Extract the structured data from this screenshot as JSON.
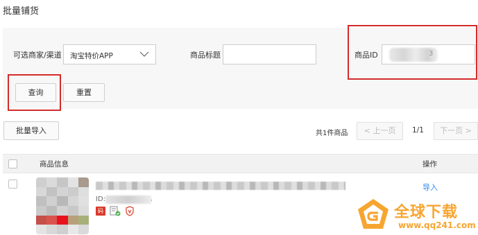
{
  "page": {
    "title": "批量铺货"
  },
  "filters": {
    "merchant_label": "可选商家/渠道",
    "merchant_value": "淘宝特价APP",
    "title_label": "商品标题",
    "title_value": "",
    "id_label": "商品ID",
    "id_value_tail": "3"
  },
  "actions": {
    "query_label": "查询",
    "reset_label": "重置",
    "bulk_import_label": "批量导入"
  },
  "pagination": {
    "total_text": "共1件商品",
    "prev_label": "< 上一页",
    "page_text": "1/1",
    "next_label": "下一页 >"
  },
  "table": {
    "col_info": "商品信息",
    "col_ops": "操作",
    "rows": [
      {
        "id_label": "ID:",
        "id_tail": ",",
        "tag": "码",
        "action_label": "导入"
      }
    ]
  },
  "watermark": {
    "text": "全球下载",
    "url": "www.qq241.com"
  },
  "colors": {
    "highlight_red": "#d42a2a",
    "link_blue": "#2d8cf0",
    "watermark_orange": "#f7a531",
    "tag_red": "#d93a2b"
  },
  "icons": [
    "chevron-down-icon",
    "code-tag-icon",
    "edit-check-icon",
    "badge-icon",
    "watermark-logo-icon"
  ]
}
